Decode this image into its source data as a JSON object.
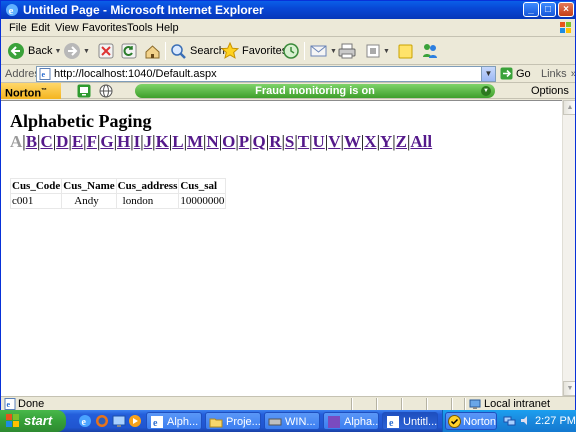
{
  "window": {
    "title": "Untitled Page - Microsoft Internet Explorer"
  },
  "menu": {
    "items": [
      "File",
      "Edit",
      "View",
      "Favorites",
      "Tools",
      "Help"
    ]
  },
  "toolbar": {
    "back_label": "Back",
    "search_label": "Search",
    "favorites_label": "Favorites"
  },
  "address": {
    "label": "Address",
    "url": "http://localhost:1040/Default.aspx",
    "go_label": "Go",
    "links_label": "Links"
  },
  "norton": {
    "logo": "Norton",
    "status": "Fraud monitoring is on",
    "options_label": "Options"
  },
  "page": {
    "heading": "Alphabetic Paging",
    "current_letter": "A",
    "letters": [
      "B",
      "C",
      "D",
      "E",
      "F",
      "G",
      "H",
      "I",
      "J",
      "K",
      "L",
      "M",
      "N",
      "O",
      "P",
      "Q",
      "R",
      "S",
      "T",
      "U",
      "V",
      "W",
      "X",
      "Y",
      "Z",
      "All"
    ],
    "table": {
      "headers": [
        "Cus_Code",
        "Cus_Name",
        "Cus_address",
        "Cus_sal"
      ],
      "rows": [
        [
          "c001",
          "Andy",
          "london",
          "10000000"
        ]
      ]
    }
  },
  "status": {
    "text": "Done",
    "zone": "Local intranet"
  },
  "taskbar": {
    "start_label": "start",
    "tasks": [
      "Alph...",
      "Proje...",
      "WIN...",
      "Alpha...",
      "Untitl..."
    ],
    "active_task": 4,
    "norton_label": "Norton",
    "clock": "2:27 PM"
  }
}
